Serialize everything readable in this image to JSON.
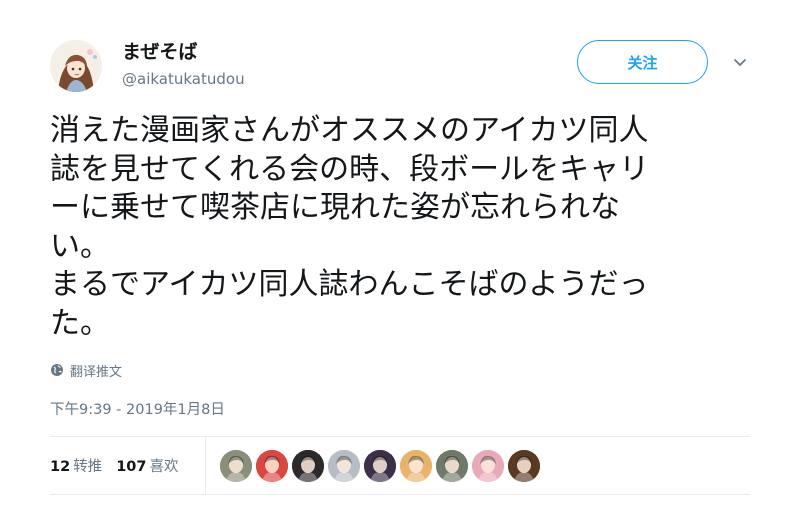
{
  "user": {
    "display_name": "まぜそば",
    "handle": "@aikatukatudou",
    "follow_label": "关注"
  },
  "tweet": {
    "lines": [
      "消えた漫画家さんがオススメのアイカツ同人",
      "誌を見せてくれる会の時、段ボールをキャリ",
      "ーに乗せて喫茶店に現れた姿が忘れられな",
      "い。",
      "まるでアイカツ同人誌わんこそばのようだっ",
      "た。"
    ],
    "translate_label": "翻译推文",
    "timestamp": "下午9:39 - 2019年1月8日"
  },
  "stats": {
    "retweets_count": "12",
    "retweets_label": "转推",
    "likes_count": "107",
    "likes_label": "喜欢"
  },
  "liker_avatars": [
    {
      "name": "liker-avatar-1",
      "color": "#8a8f7a"
    },
    {
      "name": "liker-avatar-2",
      "color": "#d9473f"
    },
    {
      "name": "liker-avatar-3",
      "color": "#2a2a2a"
    },
    {
      "name": "liker-avatar-4",
      "color": "#b7bdc8"
    },
    {
      "name": "liker-avatar-5",
      "color": "#3b2f4a"
    },
    {
      "name": "liker-avatar-6",
      "color": "#e8b36a"
    },
    {
      "name": "liker-avatar-7",
      "color": "#6f7a6a"
    },
    {
      "name": "liker-avatar-8",
      "color": "#e9a9b8"
    },
    {
      "name": "liker-avatar-9",
      "color": "#5a3a22"
    }
  ],
  "colors": {
    "accent": "#1da1f2",
    "text_primary": "#14171a",
    "text_secondary": "#657786",
    "divider": "#e6ecf0"
  }
}
